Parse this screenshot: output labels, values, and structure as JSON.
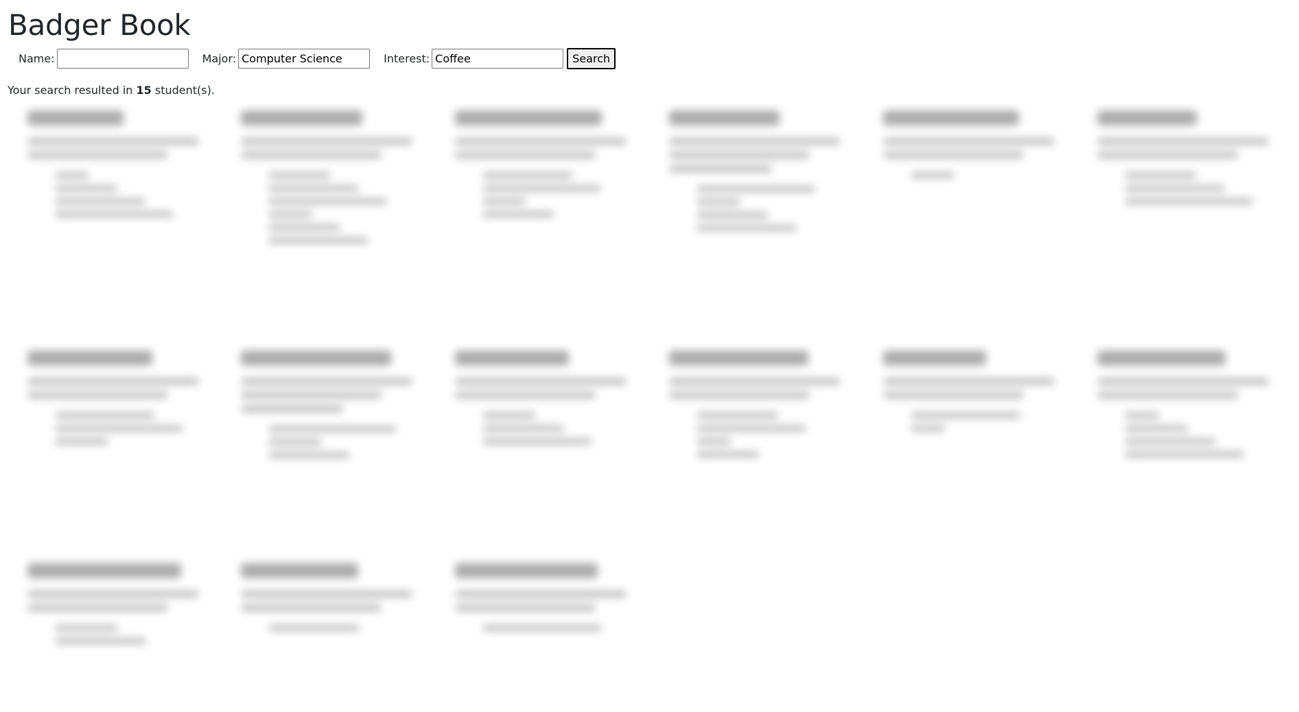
{
  "app": {
    "title": "Badger Book"
  },
  "search": {
    "name_label": "Name:",
    "name_value": "",
    "major_label": "Major:",
    "major_value": "Computer Science",
    "interest_label": "Interest:",
    "interest_value": "Coffee",
    "button_label": "Search"
  },
  "summary": {
    "prefix": "Your search resulted in ",
    "count": "15",
    "suffix": " student(s)."
  }
}
